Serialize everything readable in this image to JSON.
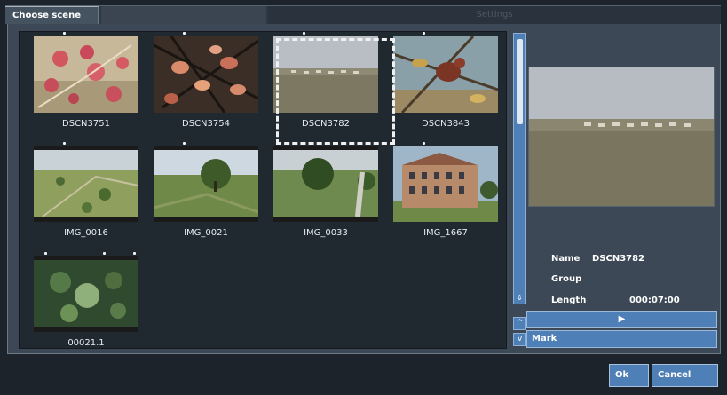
{
  "tabs": {
    "active": "Choose scene",
    "middle": "",
    "inactive": "Settings"
  },
  "scenes": [
    {
      "label": "DSCN3751"
    },
    {
      "label": "DSCN3754"
    },
    {
      "label": "DSCN3782"
    },
    {
      "label": "DSCN3843"
    },
    {
      "label": "IMG_0016"
    },
    {
      "label": "IMG_0021"
    },
    {
      "label": "IMG_0033"
    },
    {
      "label": "IMG_1667"
    },
    {
      "label": "00021.1"
    }
  ],
  "details": {
    "name_label": "Name",
    "name_value": "DSCN3782",
    "group_label": "Group",
    "group_value": "",
    "length_label": "Length",
    "length_value": "000:07:00"
  },
  "buttons": {
    "play": "▶",
    "mark": "Mark",
    "ok": "Ok",
    "cancel": "Cancel"
  },
  "icons": {
    "scroll_grip": "⇕",
    "scroll_up": "^",
    "scroll_down": "v"
  },
  "colors": {
    "accent": "#4e7fb6",
    "panel": "#3c4855",
    "window": "#1d232b"
  }
}
